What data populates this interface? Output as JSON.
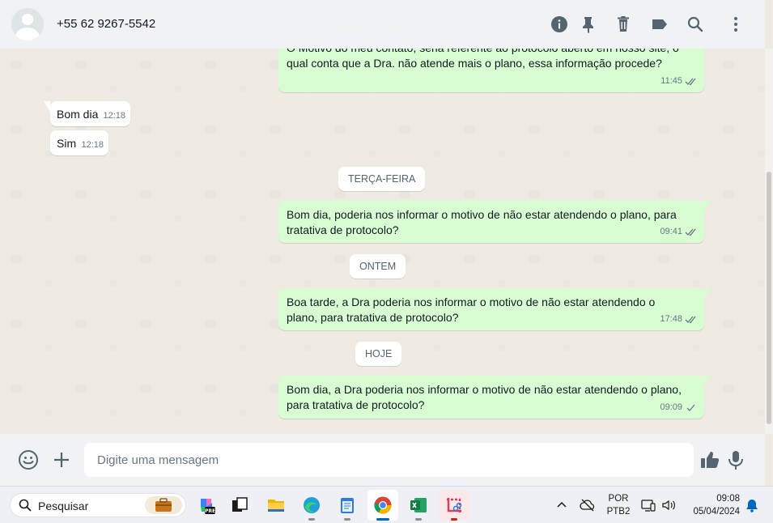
{
  "header": {
    "contact": "+55 62 9267-5542",
    "icons": [
      "info-icon",
      "pin-icon",
      "delete-icon",
      "label-icon",
      "search-icon",
      "menu-icon"
    ]
  },
  "messages": [
    {
      "dir": "out",
      "text": "O Motivo do meu contato, seria referente ao protocolo aberto em nosso site, o qual conta que a Dra. não atende mais o plano, essa informação procede?",
      "time": "11:45",
      "status": "read"
    },
    {
      "dir": "in",
      "text": "Bom dia",
      "time": "12:18"
    },
    {
      "dir": "in",
      "text": "Sim",
      "time": "12:18"
    },
    {
      "dir": "out",
      "text": "Bom dia, poderia nos informar o motivo de não estar atendendo o plano, para tratativa de protocolo?",
      "time": "09:41",
      "status": "read"
    },
    {
      "dir": "out",
      "text": "Boa tarde, a Dra poderia nos informar o motivo de não estar atendendo o plano, para tratativa de protocolo?",
      "time": "17:48",
      "status": "read"
    },
    {
      "dir": "out",
      "text": "Bom dia, a Dra poderia nos informar o motivo de não estar atendendo o plano, para tratativa de protocolo?",
      "time": "09:09",
      "status": "sent"
    }
  ],
  "date_separators": [
    "TERÇA-FEIRA",
    "ONTEM",
    "HOJE"
  ],
  "composer": {
    "placeholder": "Digite uma mensagem"
  },
  "taskbar": {
    "search_label": "Pesquisar",
    "apps": [
      "copilot",
      "task-view",
      "file-explorer",
      "edge",
      "notepad",
      "chrome",
      "excel",
      "snipping-tool"
    ],
    "active_app": "chrome",
    "language": "POR",
    "keyboard": "PTB2",
    "time": "09:08",
    "date": "05/04/2024"
  },
  "colors": {
    "outgoing_bubble": "#d9fdd3",
    "incoming_bubble": "#ffffff",
    "chat_background": "#efeae2",
    "header_background": "#f0f2f5",
    "tick_color": "#667781"
  }
}
